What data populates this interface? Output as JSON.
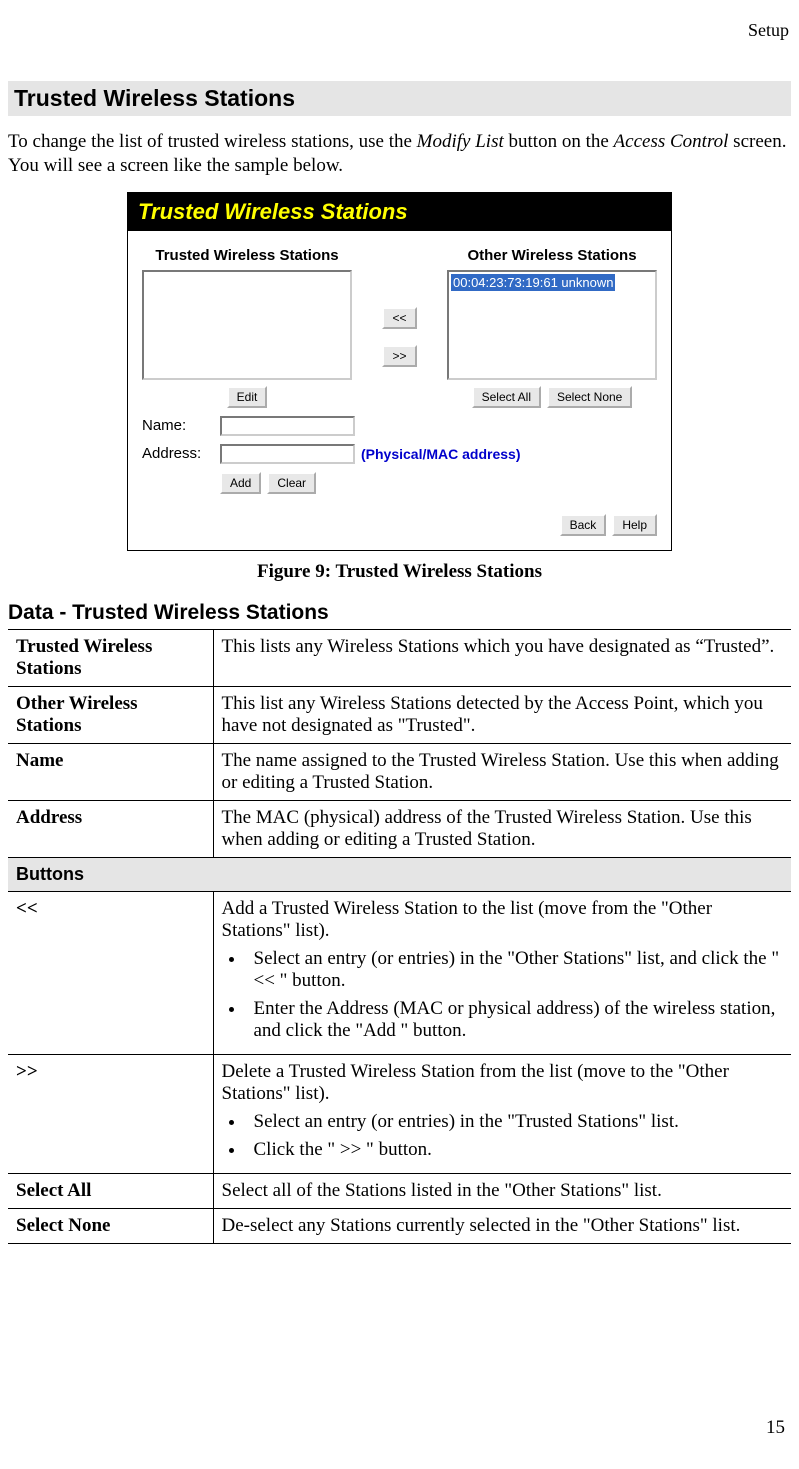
{
  "header": {
    "section": "Setup"
  },
  "heading": "Trusted Wireless Stations",
  "intro": {
    "pre": "To change the list of trusted wireless stations, use the ",
    "modify": "Modify List",
    "mid": " button on the ",
    "access": "Access Control",
    "post": " screen. You will see a screen like the sample below."
  },
  "screenshot": {
    "title": "Trusted Wireless Stations",
    "trusted_label": "Trusted Wireless Stations",
    "other_label": "Other Wireless Stations",
    "other_item": "00:04:23:73:19:61 unknown",
    "move_left": "<<",
    "move_right": ">>",
    "edit": "Edit",
    "select_all": "Select All",
    "select_none": "Select None",
    "name_label": "Name:",
    "address_label": "Address:",
    "mac_note": "(Physical/MAC address)",
    "add": "Add",
    "clear": "Clear",
    "back": "Back",
    "help": "Help"
  },
  "figure_caption": "Figure 9: Trusted Wireless Stations",
  "subheading": "Data - Trusted Wireless Stations",
  "rows": {
    "r1": {
      "k": "Trusted Wireless Stations",
      "v": "This lists any Wireless Stations which you have designated as “Trusted”."
    },
    "r2": {
      "k": "Other Wireless Stations",
      "v": "This list any Wireless Stations detected by the Access Point, which you have not designated as \"Trusted\"."
    },
    "r3": {
      "k": "Name",
      "v": "The name assigned to the Trusted Wireless Station. Use this when adding or editing a Trusted Station."
    },
    "r4": {
      "k": "Address",
      "v": "The MAC (physical) address of the Trusted Wireless Station. Use this when adding or editing a Trusted Station."
    },
    "sect": "Buttons",
    "r5": {
      "k": "<<",
      "v": "Add a Trusted Wireless Station to the list (move from the \"Other Stations\" list).",
      "b1": "Select an entry (or entries) in the \"Other Stations\" list, and click the \" << \" button.",
      "b2": "Enter the Address (MAC or physical address) of the wireless station, and click the \"Add \" button."
    },
    "r6": {
      "k": ">>",
      "v": "Delete a Trusted Wireless Station from the list (move to the \"Other Stations\" list).",
      "b1": "Select an entry (or entries) in the \"Trusted Stations\" list.",
      "b2": "Click the \" >> \" button."
    },
    "r7": {
      "k": "Select All",
      "v": "Select all of the Stations listed in the \"Other Stations\" list."
    },
    "r8": {
      "k": "Select None",
      "v": "De-select any Stations currently selected in the \"Other Stations\" list."
    }
  },
  "page_num": "15"
}
